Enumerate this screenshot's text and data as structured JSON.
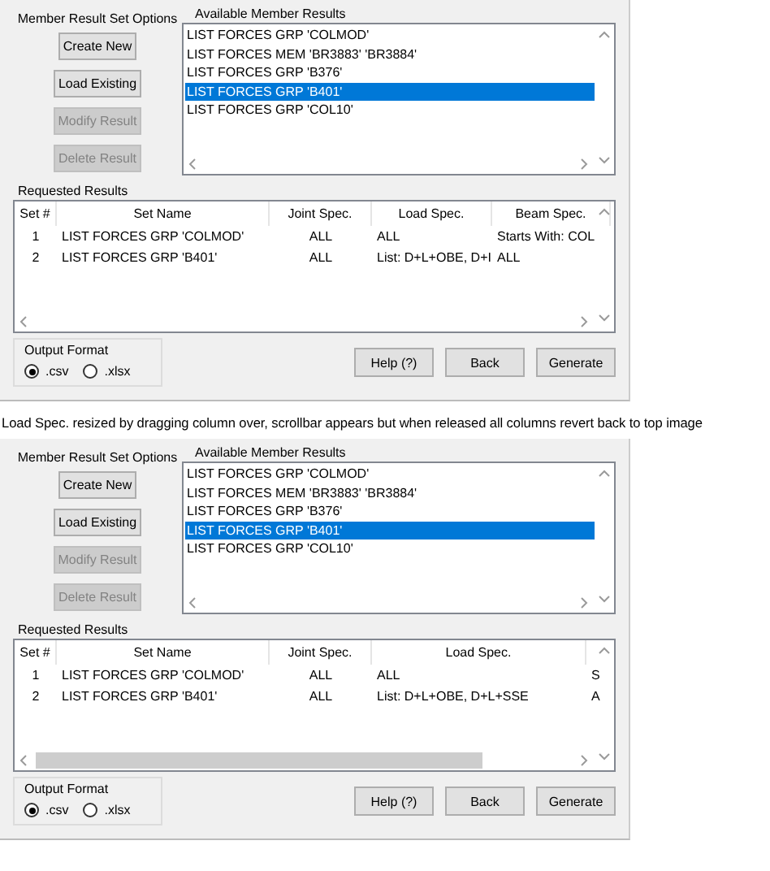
{
  "dialogs": [
    {
      "options_label": "Member Result Set Options",
      "buttons": [
        {
          "label": "Create New",
          "disabled": false
        },
        {
          "label": "Load Existing",
          "disabled": false
        },
        {
          "label": "Modify Result",
          "disabled": true
        },
        {
          "label": "Delete Result",
          "disabled": true
        }
      ],
      "available": {
        "label": "Available Member Results",
        "items": [
          {
            "text": "LIST FORCES GRP 'COLMOD'",
            "selected": false
          },
          {
            "text": "LIST FORCES MEM 'BR3883' 'BR3884'",
            "selected": false
          },
          {
            "text": "LIST FORCES GRP 'B376'",
            "selected": false
          },
          {
            "text": "LIST FORCES GRP 'B401'",
            "selected": true
          },
          {
            "text": "LIST FORCES GRP 'COL10'",
            "selected": false
          }
        ]
      },
      "requested": {
        "label": "Requested Results",
        "columns": [
          "Set #",
          "Set Name",
          "Joint Spec.",
          "Load Spec.",
          "Beam Spec."
        ],
        "rows": [
          [
            "1",
            "LIST FORCES GRP 'COLMOD'",
            "ALL",
            "ALL",
            "Starts With:  COL"
          ],
          [
            "2",
            "LIST FORCES GRP 'B401'",
            "ALL",
            "List:  D+L+OBE, D+I",
            "ALL"
          ]
        ],
        "scroll_thumb": false
      },
      "output": {
        "label": "Output Format",
        "options": [
          {
            "label": ".csv",
            "selected": true
          },
          {
            "label": ".xlsx",
            "selected": false
          }
        ]
      },
      "actions": [
        "Help (?)",
        "Back",
        "Generate"
      ]
    },
    {
      "options_label": "Member Result Set Options",
      "buttons": [
        {
          "label": "Create New",
          "disabled": false
        },
        {
          "label": "Load Existing",
          "disabled": false
        },
        {
          "label": "Modify Result",
          "disabled": true
        },
        {
          "label": "Delete Result",
          "disabled": true
        }
      ],
      "available": {
        "label": "Available Member Results",
        "items": [
          {
            "text": "LIST FORCES GRP 'COLMOD'",
            "selected": false
          },
          {
            "text": "LIST FORCES MEM 'BR3883' 'BR3884'",
            "selected": false
          },
          {
            "text": "LIST FORCES GRP 'B376'",
            "selected": false
          },
          {
            "text": "LIST FORCES GRP 'B401'",
            "selected": true
          },
          {
            "text": "LIST FORCES GRP 'COL10'",
            "selected": false
          }
        ]
      },
      "requested": {
        "label": "Requested Results",
        "columns": [
          "Set #",
          "Set Name",
          "Joint Spec.",
          "Load Spec."
        ],
        "rows": [
          [
            "1",
            "LIST FORCES GRP 'COLMOD'",
            "ALL",
            "ALL",
            "S"
          ],
          [
            "2",
            "LIST FORCES GRP 'B401'",
            "ALL",
            "List:  D+L+OBE, D+L+SSE",
            "A"
          ]
        ],
        "scroll_thumb": true
      },
      "output": {
        "label": "Output Format",
        "options": [
          {
            "label": ".csv",
            "selected": true
          },
          {
            "label": ".xlsx",
            "selected": false
          }
        ]
      },
      "actions": [
        "Help (?)",
        "Back",
        "Generate"
      ]
    }
  ],
  "caption": "Load Spec. resized by dragging column over, scrollbar appears but when released all columns revert back to top image"
}
